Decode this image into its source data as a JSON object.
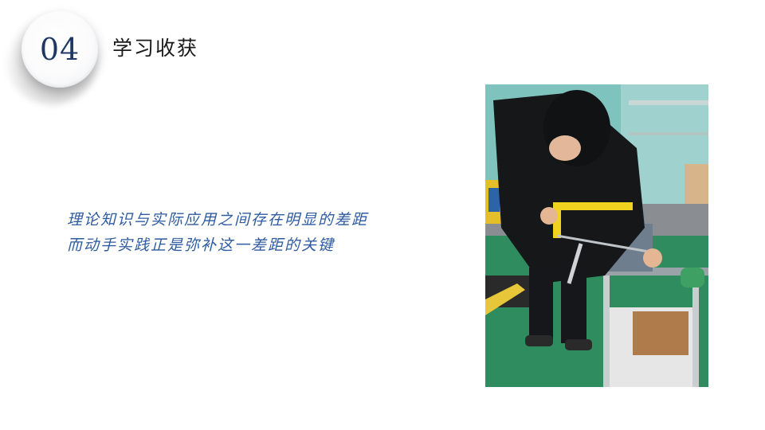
{
  "section": {
    "number": "04",
    "title": "学习收获"
  },
  "content": {
    "lines": [
      "理论知识与实际应用之间存在明显的差距",
      "而动手实践正是弥补这一差距的关键"
    ]
  },
  "photo": {
    "subject": "student sawing a workpiece in a bench vise"
  },
  "colors": {
    "badge_number": "#1f3763",
    "title": "#1a1a1a",
    "body_text": "#2e5ba0",
    "background": "#ffffff"
  }
}
